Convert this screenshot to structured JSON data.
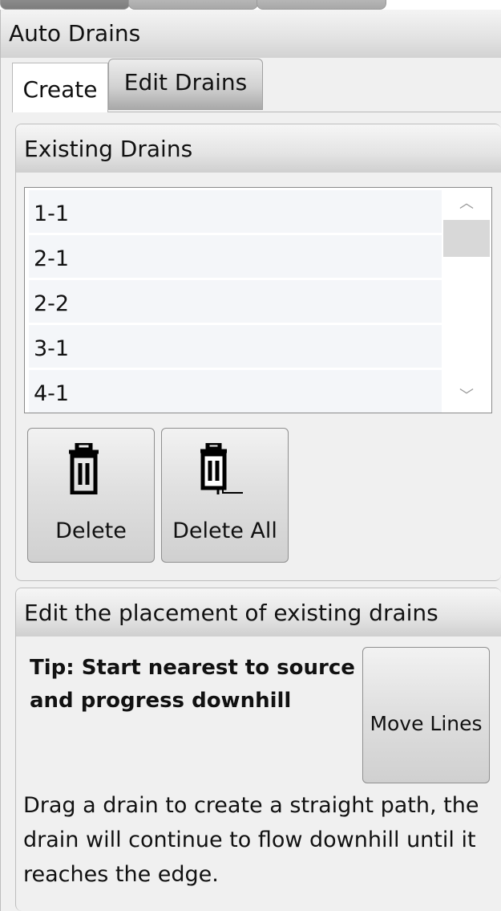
{
  "panel": {
    "title": "Auto Drains"
  },
  "tabs": [
    {
      "label": "Create",
      "selected": true
    },
    {
      "label": "Edit Drains",
      "selected": false
    }
  ],
  "existing_drains": {
    "header": "Existing Drains",
    "items": [
      "1-1",
      "2-1",
      "2-2",
      "3-1",
      "4-1"
    ],
    "scroll_up_glyph": "︿",
    "scroll_down_glyph": "﹀"
  },
  "buttons": {
    "delete_label": "Delete",
    "delete_icon": "trash-icon",
    "delete_all_label": "Delete All",
    "delete_all_icon": "trash-stack-icon",
    "move_lines_label": "Move Lines"
  },
  "edit_placement": {
    "header": "Edit the placement of existing drains",
    "tip": "Tip: Start nearest to source and progress downhill",
    "description": "Drag a drain to create a straight path, the drain will continue to flow downhill until it reaches the edge."
  },
  "colors": {
    "panel_background": "#f0f0f0",
    "list_item_background": "#f4f6f9",
    "border": "#bdbdbd"
  }
}
